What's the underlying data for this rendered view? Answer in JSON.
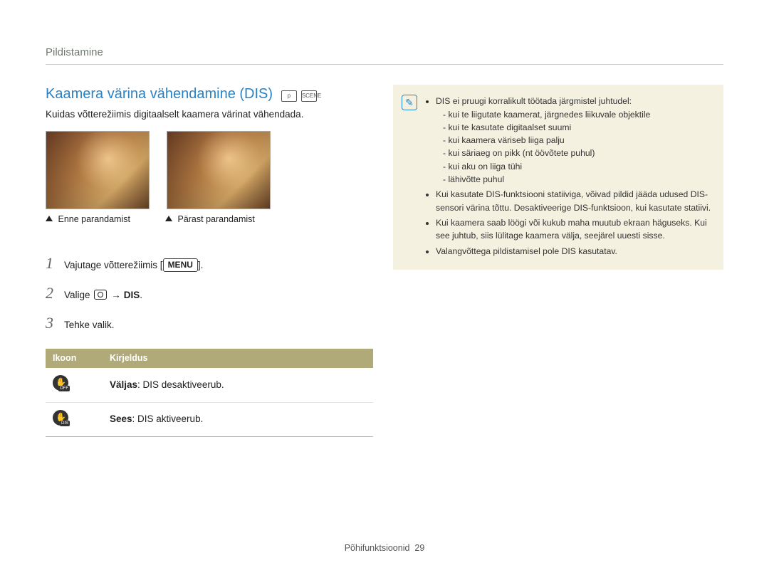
{
  "header": {
    "breadcrumb": "Pildistamine"
  },
  "main": {
    "title": "Kaamera värina vähendamine (DIS)",
    "mode_icons": [
      "p",
      "SCENE"
    ],
    "intro": "Kuidas võtterežiimis digitaalselt kaamera värinat vähendada.",
    "captions": {
      "before": "Enne parandamist",
      "after": "Pärast parandamist"
    },
    "steps": [
      {
        "num": "1",
        "prefix": "Vajutage võtterežiimis [",
        "menu": "MENU",
        "suffix": "]."
      },
      {
        "num": "2",
        "prefix": "Valige ",
        "arrow": "→",
        "target": "DIS",
        "suffix": "."
      },
      {
        "num": "3",
        "text": "Tehke valik."
      }
    ],
    "table": {
      "headers": {
        "icon": "Ikoon",
        "desc": "Kirjeldus"
      },
      "rows": [
        {
          "icon_sub": "OFF",
          "label": "Väljas",
          "desc": ": DIS desaktiveerub."
        },
        {
          "icon_sub": "DIS",
          "label": "Sees",
          "desc": ": DIS aktiveerub."
        }
      ]
    }
  },
  "note": {
    "items": [
      {
        "text": "DIS ei pruugi korralikult töötada järgmistel juhtudel:",
        "sub": [
          "kui te liigutate kaamerat, järgnedes liikuvale objektile",
          "kui te kasutate digitaalset suumi",
          "kui kaamera väriseb liiga palju",
          "kui säriaeg on pikk (nt öövõtete puhul)",
          "kui aku on liiga tühi",
          "lähivõtte puhul"
        ]
      },
      {
        "text": "Kui kasutate DIS-funktsiooni statiiviga, võivad pildid jääda udused DIS-sensori värina tõttu. Desaktiveerige DIS-funktsioon, kui kasutate statiivi."
      },
      {
        "text": "Kui kaamera saab löögi või kukub maha muutub ekraan häguseks. Kui see juhtub, siis lülitage kaamera välja, seejärel uuesti sisse."
      },
      {
        "text": "Valangvõttega pildistamisel pole DIS kasutatav."
      }
    ]
  },
  "footer": {
    "section": "Põhifunktsioonid",
    "page": "29"
  }
}
